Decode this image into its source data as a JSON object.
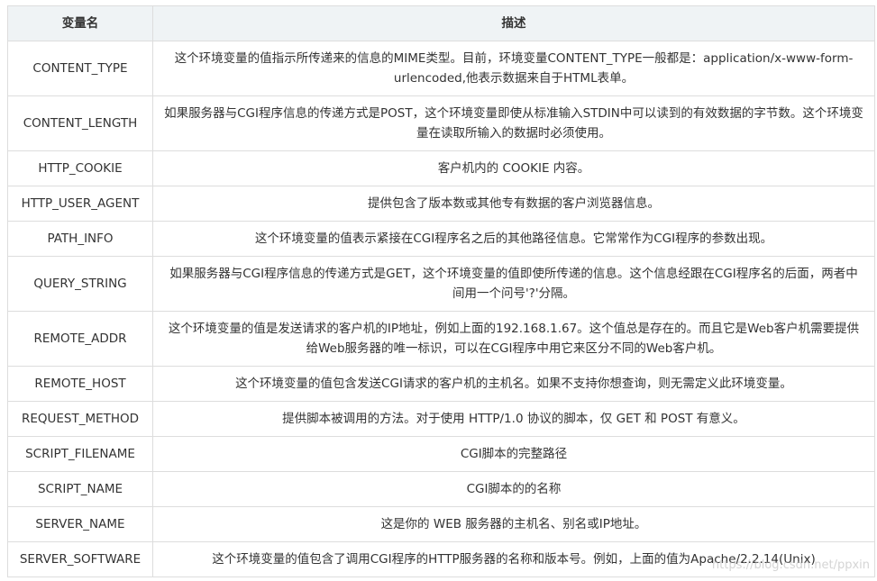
{
  "table": {
    "headers": {
      "name": "变量名",
      "desc": "描述"
    },
    "rows": [
      {
        "name": "CONTENT_TYPE",
        "desc": "这个环境变量的值指示所传递来的信息的MIME类型。目前，环境变量CONTENT_TYPE一般都是：application/x-www-form-urlencoded,他表示数据来自于HTML表单。"
      },
      {
        "name": "CONTENT_LENGTH",
        "desc": "如果服务器与CGI程序信息的传递方式是POST，这个环境变量即使从标准输入STDIN中可以读到的有效数据的字节数。这个环境变量在读取所输入的数据时必须使用。"
      },
      {
        "name": "HTTP_COOKIE",
        "desc": "客户机内的 COOKIE 内容。"
      },
      {
        "name": "HTTP_USER_AGENT",
        "desc": "提供包含了版本数或其他专有数据的客户浏览器信息。"
      },
      {
        "name": "PATH_INFO",
        "desc": "这个环境变量的值表示紧接在CGI程序名之后的其他路径信息。它常常作为CGI程序的参数出现。"
      },
      {
        "name": "QUERY_STRING",
        "desc": "如果服务器与CGI程序信息的传递方式是GET，这个环境变量的值即使所传递的信息。这个信息经跟在CGI程序名的后面，两者中间用一个问号'?'分隔。"
      },
      {
        "name": "REMOTE_ADDR",
        "desc": "这个环境变量的值是发送请求的客户机的IP地址，例如上面的192.168.1.67。这个值总是存在的。而且它是Web客户机需要提供给Web服务器的唯一标识，可以在CGI程序中用它来区分不同的Web客户机。"
      },
      {
        "name": "REMOTE_HOST",
        "desc": "这个环境变量的值包含发送CGI请求的客户机的主机名。如果不支持你想查询，则无需定义此环境变量。"
      },
      {
        "name": "REQUEST_METHOD",
        "desc": "提供脚本被调用的方法。对于使用 HTTP/1.0 协议的脚本，仅 GET 和 POST 有意义。"
      },
      {
        "name": "SCRIPT_FILENAME",
        "desc": "CGI脚本的完整路径"
      },
      {
        "name": "SCRIPT_NAME",
        "desc": "CGI脚本的的名称"
      },
      {
        "name": "SERVER_NAME",
        "desc": "这是你的 WEB 服务器的主机名、别名或IP地址。"
      },
      {
        "name": "SERVER_SOFTWARE",
        "desc": "这个环境变量的值包含了调用CGI程序的HTTP服务器的名称和版本号。例如，上面的值为Apache/2.2.14(Unix)"
      }
    ]
  },
  "watermark": "https://blog.csdn.net/ppxin"
}
